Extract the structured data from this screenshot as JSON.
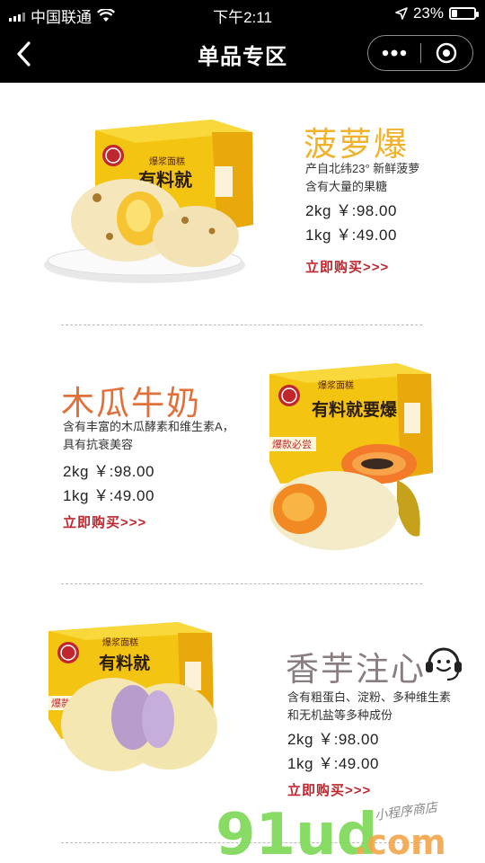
{
  "status_bar": {
    "carrier": "中国联通",
    "time": "下午2:11",
    "battery": "23%",
    "battery_level": 0.23
  },
  "nav": {
    "title": "单品专区",
    "icons": [
      "back-arrow-icon",
      "more-dots-icon",
      "record-target-icon"
    ]
  },
  "products": [
    {
      "name": "菠萝爆",
      "name_color": "#f0b22c",
      "desc": [
        "产自北纬23°  新鲜菠萝",
        "含有大量的果糖"
      ],
      "price_2kg": "2kg ￥:98.00",
      "price_1kg": "1kg ￥:49.00",
      "buy": "立即购买>>>",
      "box_brand": "爆浆面糕",
      "box_slogan": "有料就"
    },
    {
      "name": "木瓜牛奶",
      "name_color": "#e2703a",
      "desc": [
        "含有丰富的木瓜酵素和维生素A，",
        "具有抗衰美容"
      ],
      "price_2kg": "2kg  ￥:98.00",
      "price_1kg": "1kg  ￥:49.00",
      "buy": "立即购买>>>",
      "box_brand": "爆浆面糕",
      "box_slogan": "有料就要爆",
      "box_tag": "爆款必尝"
    },
    {
      "name": "香芋注心",
      "name_color": "#8a7d7f",
      "desc": [
        "含有粗蛋白、淀粉、多种维生素",
        "和无机盐等多种成份"
      ],
      "price_2kg": "2kg ￥:98.00",
      "price_1kg": "1kg ￥:49.00",
      "buy": "立即购买>>>",
      "box_brand": "爆浆面糕",
      "box_slogan": "有料就",
      "box_tag": "爆款必尝"
    }
  ],
  "watermark": {
    "logo_main": "91ud",
    "logo_dot": ".com",
    "logo_tagline": "小程序商店"
  }
}
